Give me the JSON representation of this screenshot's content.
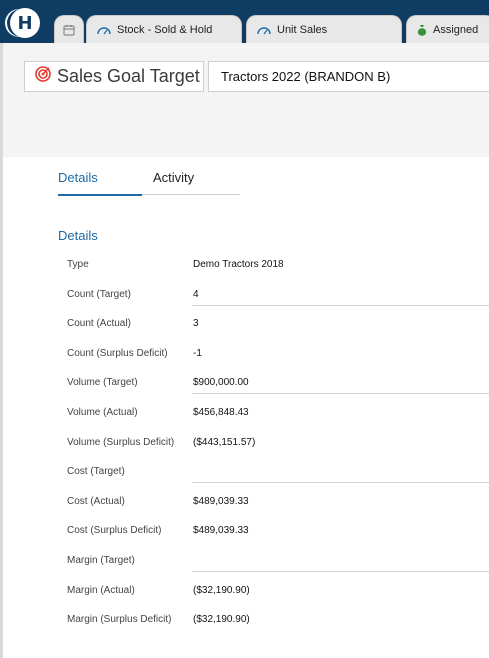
{
  "tabs": [
    {
      "label": ""
    },
    {
      "label": "Stock - Sold & Hold"
    },
    {
      "label": "Unit Sales"
    },
    {
      "label": "Assigned"
    }
  ],
  "header": {
    "title": "Sales Goal Target",
    "record": "Tractors 2022 (BRANDON B)"
  },
  "page_tabs": {
    "details": "Details",
    "activity": "Activity"
  },
  "section": {
    "title": "Details"
  },
  "fields": [
    {
      "label": "Type",
      "value": "Demo Tractors 2018"
    },
    {
      "label": "Count (Target)",
      "value": "4"
    },
    {
      "label": "Count (Actual)",
      "value": "3"
    },
    {
      "label": "Count (Surplus Deficit)",
      "value": "-1"
    },
    {
      "label": "Volume (Target)",
      "value": "$900,000.00"
    },
    {
      "label": "Volume (Actual)",
      "value": "$456,848.43"
    },
    {
      "label": "Volume (Surplus Deficit)",
      "value": "($443,151.57)"
    },
    {
      "label": "Cost (Target)",
      "value": ""
    },
    {
      "label": "Cost (Actual)",
      "value": "$489,039.33"
    },
    {
      "label": "Cost (Surplus Deficit)",
      "value": "$489,039.33"
    },
    {
      "label": "Margin (Target)",
      "value": ""
    },
    {
      "label": "Margin (Actual)",
      "value": "($32,190.90)"
    },
    {
      "label": "Margin (Surplus Deficit)",
      "value": "($32,190.90)"
    }
  ],
  "colors": {
    "topbar": "#0f3c63",
    "accent": "#1c6aa6",
    "goal_icon": "#e23b2e",
    "assigned_icon": "#3a8f3a"
  },
  "icons": [
    "calendar-icon",
    "gauge-icon",
    "gauge-icon",
    "money-bag-icon",
    "target-icon"
  ]
}
